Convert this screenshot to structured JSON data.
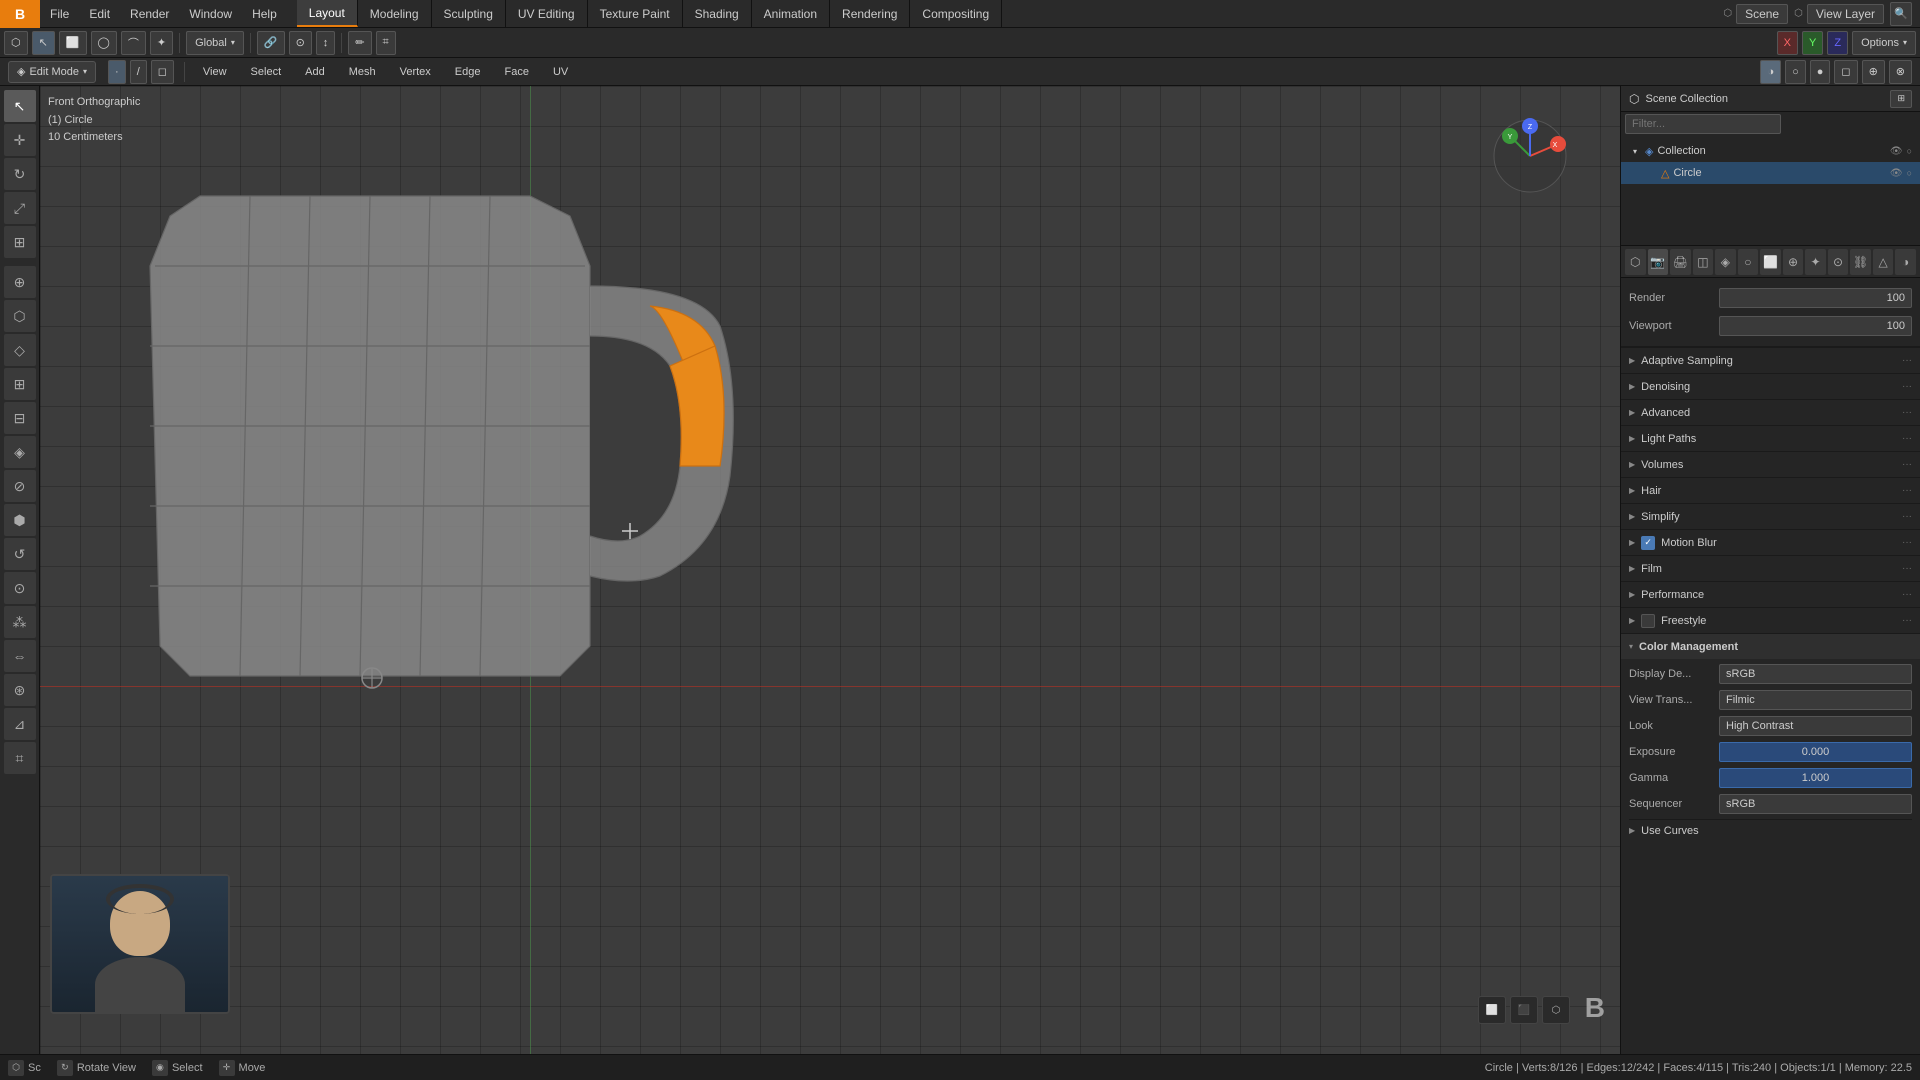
{
  "app": {
    "logo": "B",
    "title": "Blender"
  },
  "top_menu": {
    "items": [
      {
        "label": "File",
        "id": "file"
      },
      {
        "label": "Edit",
        "id": "edit"
      },
      {
        "label": "Render",
        "id": "render"
      },
      {
        "label": "Window",
        "id": "window"
      },
      {
        "label": "Help",
        "id": "help"
      }
    ],
    "tabs": [
      {
        "label": "Layout",
        "id": "layout",
        "active": true
      },
      {
        "label": "Modeling",
        "id": "modeling"
      },
      {
        "label": "Sculpting",
        "id": "sculpting"
      },
      {
        "label": "UV Editing",
        "id": "uv_editing"
      },
      {
        "label": "Texture Paint",
        "id": "texture_paint"
      },
      {
        "label": "Shading",
        "id": "shading"
      },
      {
        "label": "Animation",
        "id": "animation"
      },
      {
        "label": "Rendering",
        "id": "rendering"
      },
      {
        "label": "Compositing",
        "id": "compositing"
      }
    ],
    "scene_name": "Scene",
    "view_layer": "View Layer"
  },
  "toolbar": {
    "transform": "Global",
    "mode": "Edit Mode"
  },
  "second_toolbar": {
    "mode": "Edit Mode",
    "items": [
      "View",
      "Select",
      "Add",
      "Mesh",
      "Vertex",
      "Edge",
      "Face",
      "UV"
    ]
  },
  "viewport": {
    "title": "Front Orthographic",
    "object": "(1) Circle",
    "unit": "10 Centimeters"
  },
  "status_bar": {
    "rotate": "Rotate View",
    "select": "Select",
    "move": "Move",
    "stats": "Circle | Verts:8/126 | Edges:12/242 | Faces:4/115 | Tris:240 | Objects:1/1 | Memory: 22.5"
  },
  "outliner": {
    "collection_label": "Scene Collection",
    "items": [
      {
        "name": "Collection",
        "type": "collection",
        "expanded": true,
        "indent": 0
      },
      {
        "name": "Circle",
        "type": "mesh",
        "indent": 1,
        "active": true
      }
    ]
  },
  "properties": {
    "tabs": [
      "scene",
      "render",
      "output",
      "view_layer",
      "scene2",
      "world",
      "object",
      "modifier",
      "particles",
      "physics",
      "constraint",
      "data",
      "material",
      "shader"
    ],
    "active_tab": "render",
    "sampling": {
      "render_label": "Render",
      "render_value": "100",
      "viewport_label": "Viewport",
      "viewport_value": "100"
    },
    "sections": [
      {
        "label": "Adaptive Sampling",
        "expanded": false,
        "has_checkbox": false
      },
      {
        "label": "Denoising",
        "expanded": false,
        "has_checkbox": false
      },
      {
        "label": "Advanced",
        "expanded": false,
        "has_checkbox": false
      },
      {
        "label": "Light Paths",
        "expanded": false,
        "has_checkbox": false
      },
      {
        "label": "Volumes",
        "expanded": false,
        "has_checkbox": false
      },
      {
        "label": "Hair",
        "expanded": false,
        "has_checkbox": false
      },
      {
        "label": "Simplify",
        "expanded": false,
        "has_checkbox": false
      },
      {
        "label": "Motion Blur",
        "expanded": false,
        "has_checkbox": true,
        "checked": true
      },
      {
        "label": "Film",
        "expanded": false,
        "has_checkbox": false
      },
      {
        "label": "Performance",
        "expanded": false,
        "has_checkbox": false
      },
      {
        "label": "Freestyle",
        "expanded": false,
        "has_checkbox": false
      }
    ],
    "color_management": {
      "label": "Color Management",
      "display_device_label": "Display De...",
      "display_device_value": "sRGB",
      "view_transform_label": "View Trans...",
      "view_transform_value": "Filmic",
      "look_label": "Look",
      "look_value": "High Contrast",
      "exposure_label": "Exposure",
      "exposure_value": "0.000",
      "gamma_label": "Gamma",
      "gamma_value": "1.000",
      "sequencer_label": "Sequencer",
      "sequencer_value": "sRGB",
      "use_curves_label": "Use Curves"
    }
  }
}
